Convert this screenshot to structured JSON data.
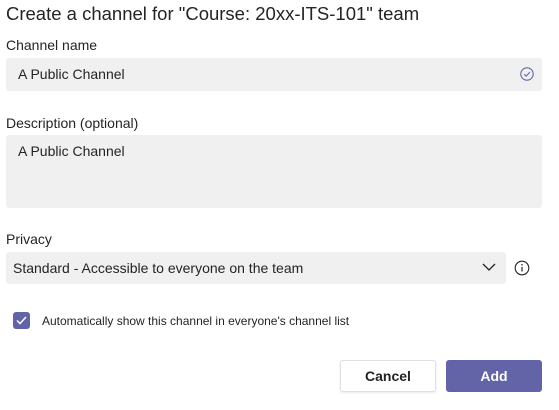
{
  "dialog": {
    "title": "Create a channel for \"Course: 20xx-ITS-101\" team"
  },
  "channel_name": {
    "label": "Channel name",
    "value": "A Public Channel",
    "status_icon": "check-circle-icon"
  },
  "description": {
    "label": "Description (optional)",
    "value": "A Public Channel"
  },
  "privacy": {
    "label": "Privacy",
    "selected": "Standard - Accessible to everyone on the team",
    "dropdown_icon": "chevron-down-icon",
    "info_icon": "info-icon"
  },
  "auto_show": {
    "checked": true,
    "label": "Automatically show this channel in everyone's channel list"
  },
  "buttons": {
    "cancel": "Cancel",
    "add": "Add"
  },
  "colors": {
    "accent": "#6264a7",
    "input_bg": "#f0f0f0",
    "text": "#252423"
  }
}
